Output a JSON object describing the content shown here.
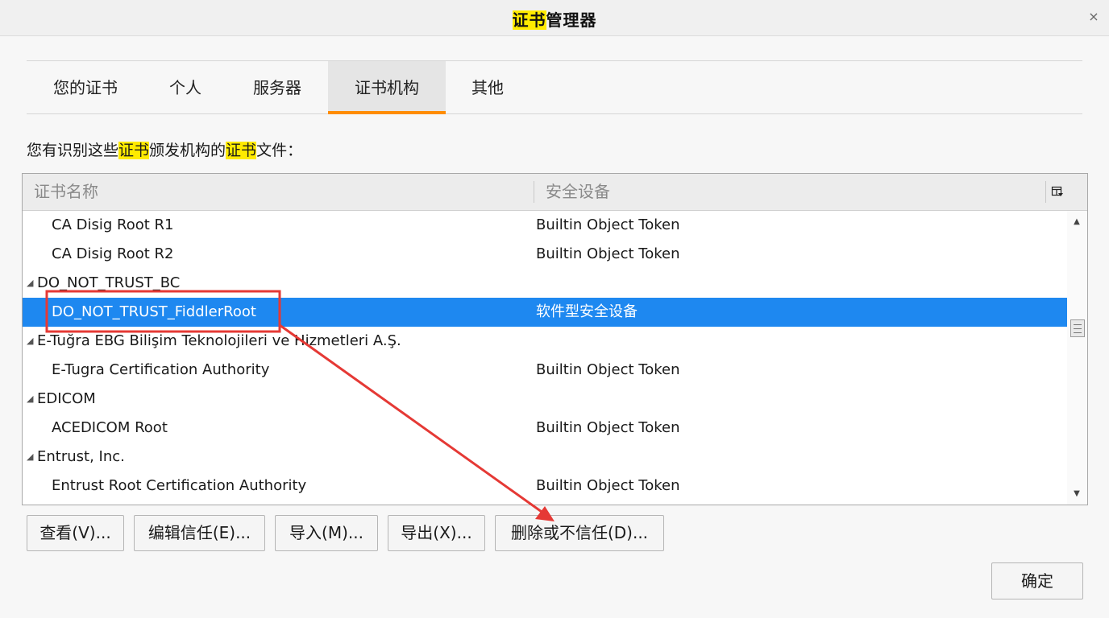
{
  "window": {
    "title_highlight": "证书",
    "title_rest": "管理器",
    "close_glyph": "×"
  },
  "tabs": [
    {
      "label": "您的证书",
      "active": false
    },
    {
      "label": "个人",
      "active": false
    },
    {
      "label": "服务器",
      "active": false
    },
    {
      "label": "证书机构",
      "active": true
    },
    {
      "label": "其他",
      "active": false
    }
  ],
  "description": {
    "part1": "您有识别这些",
    "hl1": "证书",
    "part2": "颁发机构的",
    "hl2": "证书",
    "part3": "文件："
  },
  "tree": {
    "columns": {
      "name": "证书名称",
      "device": "安全设备"
    },
    "rows": [
      {
        "type": "item",
        "name": "CA Disig Root R1",
        "device": "Builtin Object Token"
      },
      {
        "type": "item",
        "name": "CA Disig Root R2",
        "device": "Builtin Object Token"
      },
      {
        "type": "group",
        "name": "DO_NOT_TRUST_BC",
        "device": ""
      },
      {
        "type": "item",
        "name": "DO_NOT_TRUST_FiddlerRoot",
        "device": "软件型安全设备",
        "selected": true
      },
      {
        "type": "group",
        "name": "E-Tuğra EBG Bilişim Teknolojileri ve Hizmetleri A.Ş.",
        "device": ""
      },
      {
        "type": "item",
        "name": "E-Tugra Certification Authority",
        "device": "Builtin Object Token"
      },
      {
        "type": "group",
        "name": "EDICOM",
        "device": ""
      },
      {
        "type": "item",
        "name": "ACEDICOM Root",
        "device": "Builtin Object Token"
      },
      {
        "type": "group",
        "name": "Entrust, Inc.",
        "device": ""
      },
      {
        "type": "item",
        "name": "Entrust Root Certification Authority",
        "device": "Builtin Object Token"
      }
    ]
  },
  "buttons": {
    "view": "查看(V)...",
    "edit_trust": "编辑信任(E)...",
    "import": "导入(M)...",
    "export": "导出(X)...",
    "delete": "删除或不信任(D)...",
    "ok": "确定"
  },
  "annotation": {
    "color": "#e53935"
  },
  "icons": {
    "twisty": "triangle-expanded-icon",
    "column_picker": "column-picker-icon",
    "close": "close-icon"
  }
}
